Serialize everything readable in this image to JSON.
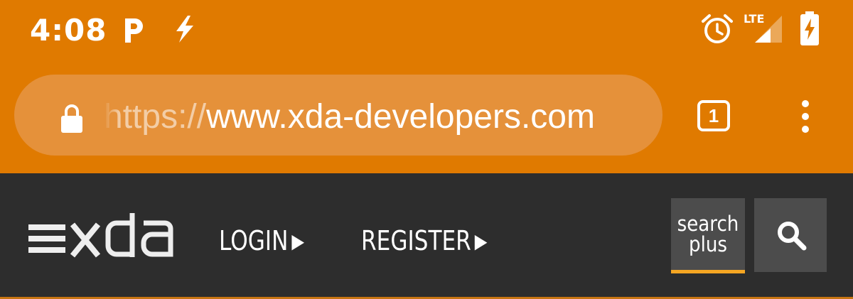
{
  "status_bar": {
    "time": "4:08",
    "network": "LTE",
    "icons": [
      "p-icon",
      "bolt-icon",
      "alarm-icon",
      "lte-signal-icon",
      "battery-charging-icon"
    ]
  },
  "browser": {
    "url_scheme": "https://",
    "url_host": "www.xda-developers.com",
    "tab_count": "1",
    "toolbar_color": "#e07a00",
    "menu_icon": "more-vert-icon"
  },
  "site_header": {
    "logo_text": "xda",
    "login_label": "LOGIN",
    "register_label": "REGISTER",
    "search_plus_line1": "search",
    "search_plus_line2": "plus",
    "search_icon": "search-icon",
    "accent_color": "#f5a623",
    "background_color": "#2d2d2d"
  }
}
